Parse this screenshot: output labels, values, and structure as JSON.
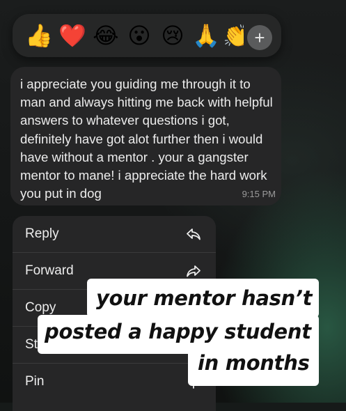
{
  "reactions": {
    "emojis": [
      {
        "name": "thumbs-up-icon",
        "glyph": "👍"
      },
      {
        "name": "heart-icon",
        "glyph": "❤️"
      },
      {
        "name": "laughing-icon",
        "glyph": "😂"
      },
      {
        "name": "surprised-icon",
        "glyph": "😮"
      },
      {
        "name": "crying-icon",
        "glyph": "😢"
      },
      {
        "name": "praying-hands-icon",
        "glyph": "🙏"
      },
      {
        "name": "clapping-icon",
        "glyph": "👏"
      }
    ],
    "add_label": "+"
  },
  "message": {
    "text": "i appreciate you guiding me through it to man and always hitting me back with helpful answers to whatever questions i got, definitely have got alot further then i would have without a mentor . your a gangster mentor to mane! i appreciate the hard work you put in dog",
    "time": "9:15 PM"
  },
  "menu": {
    "items": [
      {
        "label": "Reply",
        "icon": "reply-icon"
      },
      {
        "label": "Forward",
        "icon": "forward-icon"
      },
      {
        "label": "Copy",
        "icon": "copy-icon"
      },
      {
        "label": "St",
        "icon": "star-icon"
      },
      {
        "label": "Pin",
        "icon": "pin-icon"
      }
    ]
  },
  "caption": {
    "line1": "your mentor hasn’t",
    "line2": "posted a happy student",
    "line3": "in months"
  }
}
